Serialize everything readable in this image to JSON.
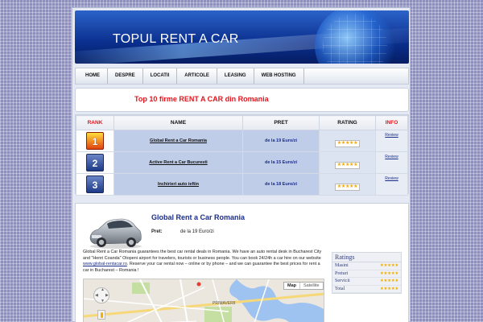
{
  "header": {
    "site_title": "TOPUL RENT A CAR"
  },
  "nav": {
    "items": [
      "HOME",
      "DESPRE",
      "LOCATII",
      "ARTICOLE",
      "LEASING",
      "WEB HOSTING"
    ]
  },
  "top": {
    "heading": "Top 10 firme RENT A CAR din Romania"
  },
  "table": {
    "headers": {
      "rank": "RANK",
      "name": "NAME",
      "price": "PRET",
      "rating": "RATING",
      "info": "INFO"
    },
    "rows": [
      {
        "rank": "1",
        "name": "Global Rent a Car Romania",
        "price": "de la 19 Euro/zi",
        "stars": "★★★★★",
        "review": "Review"
      },
      {
        "rank": "2",
        "name": "Active Rent a Car Bucuresti",
        "price": "de la 15 Euro/zi",
        "stars": "★★★★★",
        "review": "Review"
      },
      {
        "rank": "3",
        "name": "Inchirieri auto ieftin",
        "price": "de la 18 Euro/zi",
        "stars": "★★★★★",
        "review": "Review"
      }
    ]
  },
  "detail": {
    "title": "Global Rent a Car Romania",
    "price_label": "Pret:",
    "price_value": "de la 19 Euro/zi",
    "desc_part1": "Global Rent a Car Romania guarantees the best car rental deals in Romania. We have an auto rental desk in Bucharest City and \"Henri Coanda\" Otopeni airport for travelers, tourists or business people. You can book 24/24h a car hire on our website ",
    "desc_link": "www.global-rentacar.ro",
    "desc_part2": ". Reserve your car rental now – online or by phone – and we can guarantee the best prices for rent a car in Bucharest – Romania !"
  },
  "ratings": {
    "title": "Ratings",
    "rows": [
      {
        "label": "Masini",
        "stars": "★★★★★"
      },
      {
        "label": "Preturi",
        "stars": "★★★★★"
      },
      {
        "label": "Servicii",
        "stars": "★★★★★"
      },
      {
        "label": "Total",
        "stars": "★★★★★"
      }
    ]
  },
  "map": {
    "map_label": "Map",
    "satellite_label": "Satellite",
    "place_label": "PRIMAVERII",
    "colors": {
      "water": "#9ec3f0",
      "park": "#c5dea1",
      "road": "#ffffff",
      "major_road": "#f6d879"
    }
  }
}
